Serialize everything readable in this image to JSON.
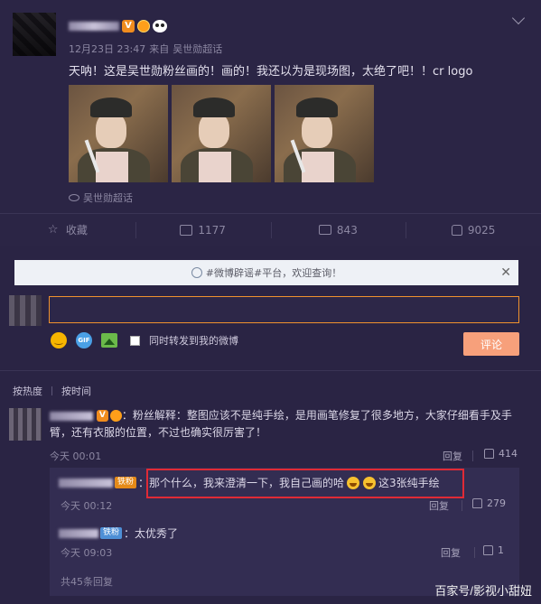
{
  "post": {
    "meta_time": "12月23日 23:47",
    "meta_from": "来自",
    "meta_source": "吴世勋超话",
    "text": "天呐！这是吴世勋粉丝画的！画的！我还以为是现场图，太绝了吧！！cr logo",
    "topic": "吴世勋超话"
  },
  "actions": [
    {
      "label": "收藏"
    },
    {
      "label": "1177"
    },
    {
      "label": "843"
    },
    {
      "label": "9025"
    }
  ],
  "composer": {
    "notice": "#微博辟谣#平台，欢迎查询！",
    "notice_close": "✕",
    "repost_label": "同时转发到我的微博",
    "submit_label": "评论"
  },
  "sort": {
    "hot": "按热度",
    "time": "按时间"
  },
  "comment": {
    "text": "：粉丝解释：整图应该不是纯手绘，是用画笔修复了很多地方，大家仔细看手及手臂，还有衣服的位置，不过也确实很厉害了！",
    "time": "今天 00:01",
    "reply": "回复",
    "likes": "414"
  },
  "replies": [
    {
      "badge": "铁粉",
      "text_before": "：那个什么，我来澄清一下，我自己画的哈",
      "text_after": "这3张纯手绘",
      "time": "今天 00:12",
      "reply": "回复",
      "likes": "279"
    },
    {
      "badge": "铁粉",
      "text_before": "：太优秀了",
      "time": "今天 09:03",
      "reply": "回复",
      "likes": "1"
    }
  ],
  "total_replies": "共45条回复",
  "watermark": "百家号/影视小甜妞"
}
